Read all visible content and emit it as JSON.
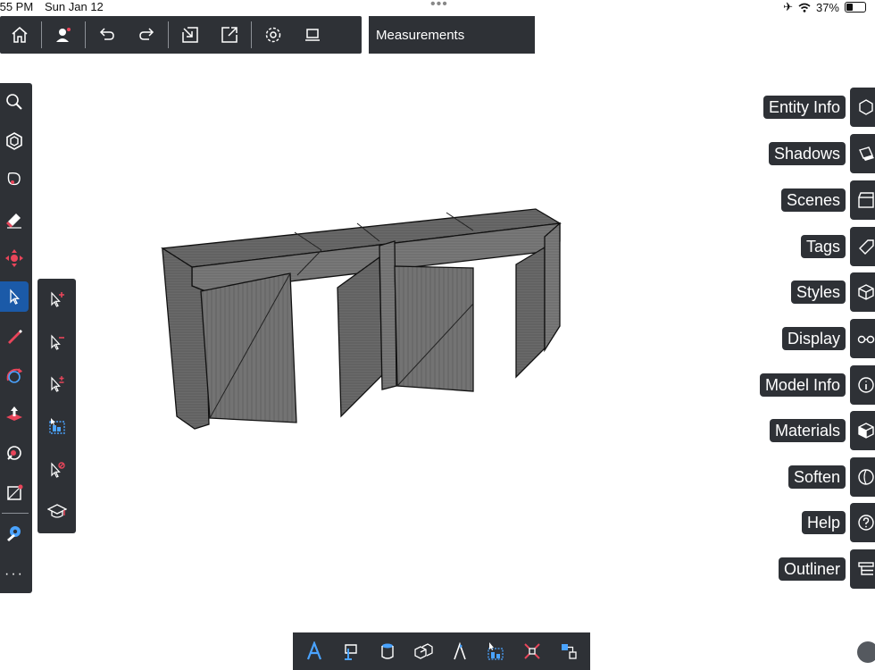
{
  "status_bar": {
    "time": ":55 PM",
    "date": "Sun Jan 12",
    "battery": "37%"
  },
  "toolbar": {
    "items": [
      "home-icon",
      "user-icon",
      "undo-icon",
      "redo-icon",
      "import-icon",
      "export-icon",
      "settings-icon",
      "display-mode-icon"
    ]
  },
  "measurements": {
    "label": "Measurements"
  },
  "left_tools": [
    "search-icon",
    "components-icon",
    "lasso-icon",
    "eraser-icon",
    "move-icon",
    "select-icon",
    "pencil-icon",
    "orbit-icon",
    "push-pull-icon",
    "paint-icon",
    "rectangle-icon",
    "tape-measure-icon",
    "more-icon"
  ],
  "select_subtools": [
    "select-add-icon",
    "select-remove-icon",
    "select-toggle-icon",
    "select-box-icon",
    "select-clear-icon",
    "learn-icon"
  ],
  "right_panels": [
    {
      "label": "Entity Info",
      "icon": "entity-info-icon"
    },
    {
      "label": "Shadows",
      "icon": "shadows-icon"
    },
    {
      "label": "Scenes",
      "icon": "scenes-icon"
    },
    {
      "label": "Tags",
      "icon": "tags-icon"
    },
    {
      "label": "Styles",
      "icon": "styles-icon"
    },
    {
      "label": "Display",
      "icon": "display-icon"
    },
    {
      "label": "Model Info",
      "icon": "model-info-icon"
    },
    {
      "label": "Materials",
      "icon": "materials-icon"
    },
    {
      "label": "Soften",
      "icon": "soften-icon"
    },
    {
      "label": "Help",
      "icon": "help-icon"
    },
    {
      "label": "Outliner",
      "icon": "outliner-icon"
    }
  ],
  "bottom_tools": [
    "text-icon",
    "dimension-icon",
    "cylinder-icon",
    "solid-tools-icon",
    "section-icon",
    "scale-icon",
    "explode-icon",
    "component-options-icon"
  ],
  "colors": {
    "panel": "#2e3136",
    "active": "#1b5aa8",
    "accent": "#e8455a"
  }
}
